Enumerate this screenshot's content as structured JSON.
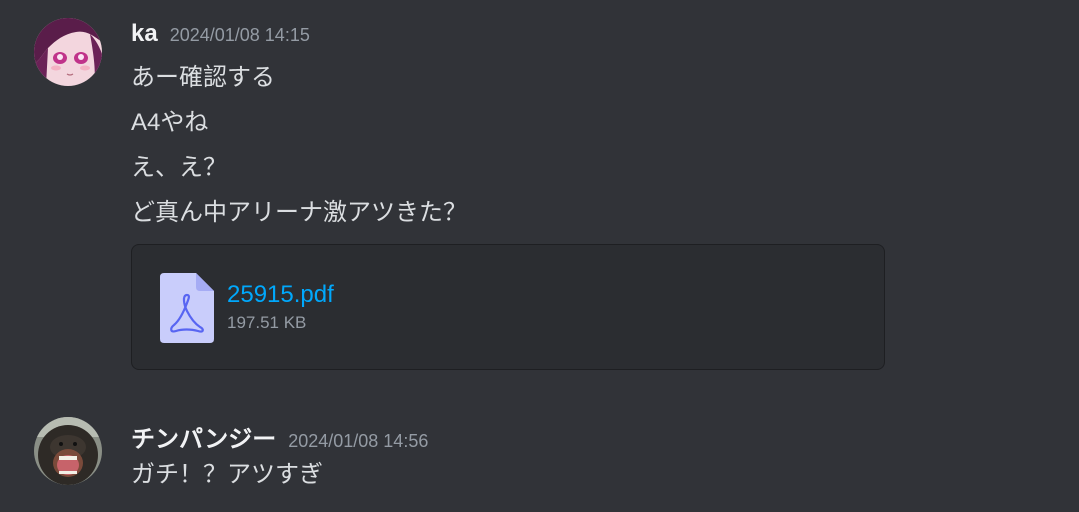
{
  "messages": [
    {
      "author": "ka",
      "timestamp": "2024/01/08 14:15",
      "avatar": "anime-girl-avatar",
      "lines": [
        "あー確認する",
        "A4やね",
        "え、え？",
        "ど真ん中アリーナ激アツきた？"
      ],
      "attachment": {
        "icon": "pdf-file-icon",
        "filename": "25915.pdf",
        "size": "197.51 KB"
      }
    },
    {
      "author": "チンパンジー",
      "timestamp": "2024/01/08 14:56",
      "avatar": "chimpanzee-avatar",
      "lines": [
        "ガチ！？アツすぎ"
      ]
    }
  ],
  "colors": {
    "background": "#313338",
    "attachment_bg": "#2b2d31",
    "link": "#00a8fc",
    "text": "#dbdee1",
    "muted": "#949ba4",
    "file_icon": "#c9cdfb",
    "file_icon_accent": "#5865f2"
  }
}
